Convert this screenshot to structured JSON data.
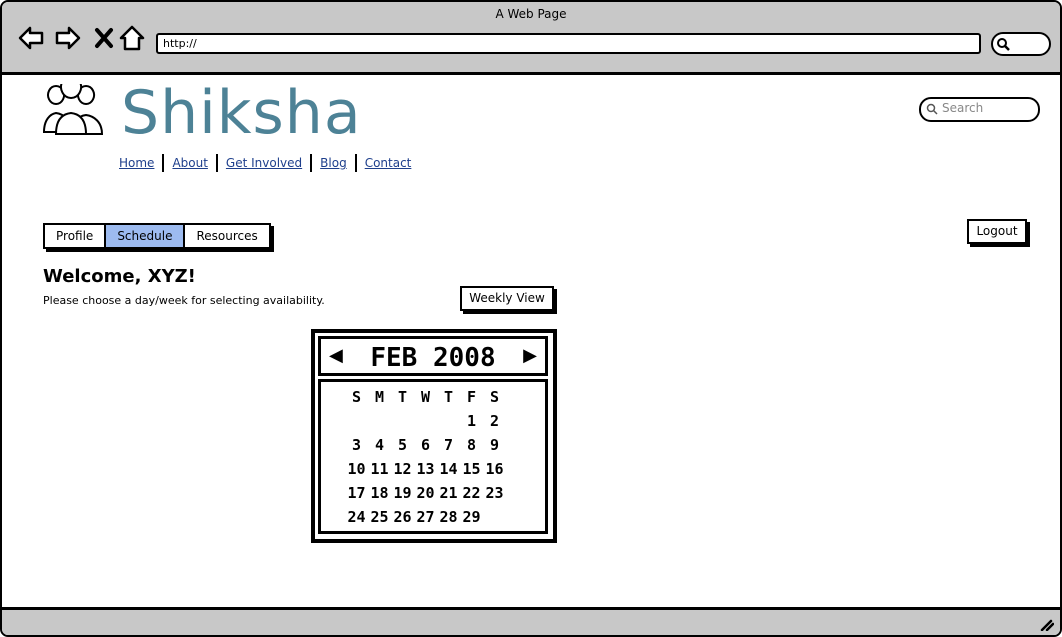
{
  "browser": {
    "title": "A Web Page",
    "url": "http://",
    "icons": [
      "back-arrow-icon",
      "forward-arrow-icon",
      "close-icon",
      "home-icon",
      "search-icon"
    ]
  },
  "site": {
    "name": "Shiksha",
    "logo_icon": "people-group-icon",
    "brand_color": "#4d8296",
    "search_placeholder": "Search"
  },
  "nav": {
    "items": [
      {
        "label": "Home"
      },
      {
        "label": "About"
      },
      {
        "label": "Get Involved"
      },
      {
        "label": "Blog"
      },
      {
        "label": "Contact"
      }
    ]
  },
  "tabs": {
    "items": [
      {
        "label": "Profile"
      },
      {
        "label": "Schedule",
        "active": true
      },
      {
        "label": "Resources"
      }
    ],
    "active_color": "#9dbbf0"
  },
  "account": {
    "logout_label": "Logout"
  },
  "main": {
    "welcome": "Welcome, XYZ!",
    "instruction": "Please choose a day/week for selecting availability.",
    "weekly_view_label": "Weekly View"
  },
  "calendar": {
    "month_label": "FEB 2008",
    "weekday_headers": [
      "S",
      "M",
      "T",
      "W",
      "T",
      "F",
      "S"
    ],
    "days": [
      [
        "",
        "",
        "",
        "",
        "",
        "1",
        "2"
      ],
      [
        "3",
        "4",
        "5",
        "6",
        "7",
        "8",
        "9"
      ],
      [
        "10",
        "11",
        "12",
        "13",
        "14",
        "15",
        "16"
      ],
      [
        "17",
        "18",
        "19",
        "20",
        "21",
        "22",
        "23"
      ],
      [
        "24",
        "25",
        "26",
        "27",
        "28",
        "29",
        ""
      ]
    ]
  }
}
